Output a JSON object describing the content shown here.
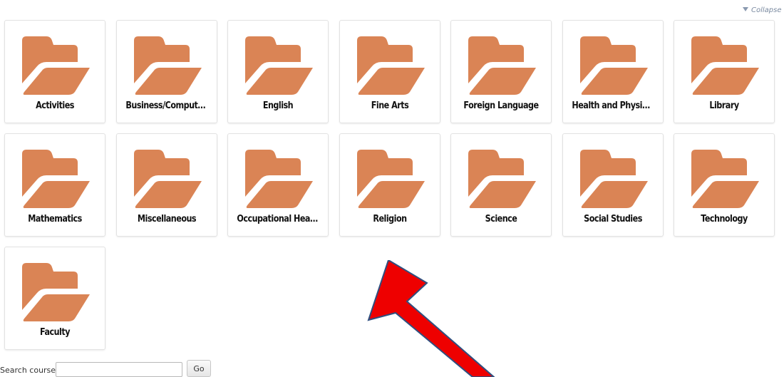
{
  "collapse": {
    "label": "Collapse a"
  },
  "categories": [
    {
      "name": "Activities"
    },
    {
      "name": "Business/Computer Ed..."
    },
    {
      "name": "English"
    },
    {
      "name": "Fine Arts"
    },
    {
      "name": "Foreign Language"
    },
    {
      "name": "Health and Physical Ed..."
    },
    {
      "name": "Library"
    },
    {
      "name": "Mathematics"
    },
    {
      "name": "Miscellaneous"
    },
    {
      "name": "Occupational Health"
    },
    {
      "name": "Religion"
    },
    {
      "name": "Science"
    },
    {
      "name": "Social Studies"
    },
    {
      "name": "Technology"
    },
    {
      "name": "Faculty"
    }
  ],
  "search": {
    "label": "Search courses:",
    "value": "",
    "button_label": "Go"
  },
  "icons": {
    "category": "folder-icon",
    "annotation": "red-arrow-annotation"
  },
  "colors": {
    "folder": "#DA8455",
    "arrow_fill": "#EE0000",
    "arrow_stroke": "#2F4F7F"
  }
}
